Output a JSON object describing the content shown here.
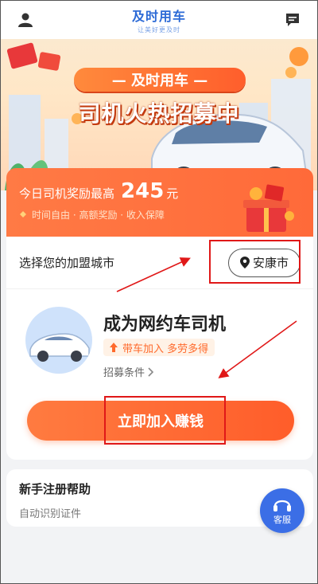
{
  "header": {
    "logo_title": "及时用车",
    "logo_sub": "让美好更及时"
  },
  "banner": {
    "tag": "— 及时用车 —",
    "headline": "司机火热招募中"
  },
  "reward": {
    "prefix": "今日司机奖励最高",
    "amount": "245",
    "unit": "元",
    "sub": "时间自由 · 高额奖励 · 收入保障"
  },
  "city": {
    "label": "选择您的加盟城市",
    "selected": "安康市"
  },
  "driver": {
    "title": "成为网约车司机",
    "chip": "带车加入 多劳多得",
    "conditions": "招募条件"
  },
  "actions": {
    "join": "立即加入赚钱"
  },
  "help": {
    "title": "新手注册帮助",
    "sub": "自动识别证件"
  },
  "service": {
    "label": "客服"
  },
  "colors": {
    "accent": "#ff6a39",
    "brand": "#2c6ad6",
    "annotation": "#e01818"
  }
}
